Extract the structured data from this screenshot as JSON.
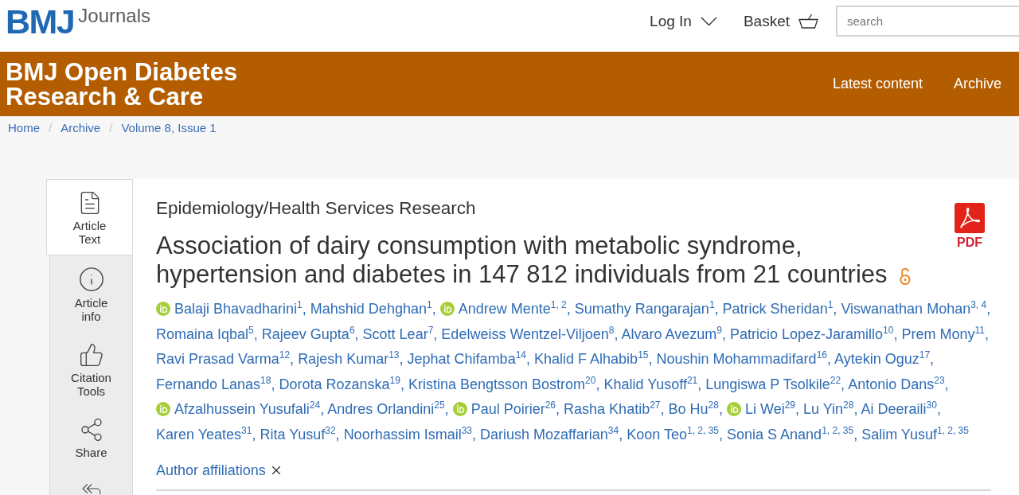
{
  "header": {
    "logo": {
      "mark": "BMJ",
      "wordmark": "Journals"
    },
    "login": {
      "label": "Log In"
    },
    "basket": {
      "label": "Basket"
    },
    "search": {
      "placeholder": "search"
    }
  },
  "journal_bar": {
    "title": "BMJ Open Diabetes Research & Care",
    "nav": [
      {
        "label": "Latest content"
      },
      {
        "label": "Archive"
      }
    ]
  },
  "breadcrumb": {
    "items": [
      "Home",
      "Archive",
      "Volume 8, Issue 1"
    ],
    "separator": "/"
  },
  "article_tabs": [
    {
      "label": "Article Text",
      "selected": true
    },
    {
      "label": "Article info",
      "selected": false
    },
    {
      "label": "Citation Tools",
      "selected": false
    },
    {
      "label": "Share",
      "selected": false
    },
    {
      "selected": false
    }
  ],
  "article": {
    "section": "Epidemiology/Health Services Research",
    "title": "Association of dairy consumption with metabolic syndrome, hypertension and diabetes in 147 812 individuals from 21 countries",
    "open_access": true,
    "pdf": {
      "label": "PDF"
    },
    "author_separator": ",",
    "authors": [
      {
        "name": "Balaji Bhavadharini",
        "affiliations": "1",
        "orcid": true
      },
      {
        "name": "Mahshid Dehghan",
        "affiliations": "1",
        "orcid": false
      },
      {
        "name": "Andrew Mente",
        "affiliations": "1, 2",
        "orcid": true
      },
      {
        "name": "Sumathy Rangarajan",
        "affiliations": "1",
        "orcid": false
      },
      {
        "name": "Patrick Sheridan",
        "affiliations": "1",
        "orcid": false
      },
      {
        "name": "Viswanathan Mohan",
        "affiliations": "3, 4",
        "orcid": false
      },
      {
        "name": "Romaina Iqbal",
        "affiliations": "5",
        "orcid": false
      },
      {
        "name": "Rajeev Gupta",
        "affiliations": "6",
        "orcid": false
      },
      {
        "name": "Scott Lear",
        "affiliations": "7",
        "orcid": false
      },
      {
        "name": "Edelweiss Wentzel-Viljoen",
        "affiliations": "8",
        "orcid": false
      },
      {
        "name": "Alvaro Avezum",
        "affiliations": "9",
        "orcid": false
      },
      {
        "name": "Patricio Lopez-Jaramillo",
        "affiliations": "10",
        "orcid": false
      },
      {
        "name": "Prem Mony",
        "affiliations": "11",
        "orcid": false
      },
      {
        "name": "Ravi Prasad Varma",
        "affiliations": "12",
        "orcid": false
      },
      {
        "name": "Rajesh Kumar",
        "affiliations": "13",
        "orcid": false
      },
      {
        "name": "Jephat Chifamba",
        "affiliations": "14",
        "orcid": false
      },
      {
        "name": "Khalid F Alhabib",
        "affiliations": "15",
        "orcid": false
      },
      {
        "name": "Noushin Mohammadifard",
        "affiliations": "16",
        "orcid": false
      },
      {
        "name": "Aytekin Oguz",
        "affiliations": "17",
        "orcid": false
      },
      {
        "name": "Fernando Lanas",
        "affiliations": "18",
        "orcid": false
      },
      {
        "name": "Dorota Rozanska",
        "affiliations": "19",
        "orcid": false
      },
      {
        "name": "Kristina Bengtsson Bostrom",
        "affiliations": "20",
        "orcid": false
      },
      {
        "name": "Khalid Yusoff",
        "affiliations": "21",
        "orcid": false
      },
      {
        "name": "Lungiswa P Tsolkile",
        "affiliations": "22",
        "orcid": false
      },
      {
        "name": "Antonio Dans",
        "affiliations": "23",
        "orcid": false
      },
      {
        "name": "Afzalhussein Yusufali",
        "affiliations": "24",
        "orcid": true
      },
      {
        "name": "Andres Orlandini",
        "affiliations": "25",
        "orcid": false
      },
      {
        "name": "Paul Poirier",
        "affiliations": "26",
        "orcid": true
      },
      {
        "name": "Rasha Khatib",
        "affiliations": "27",
        "orcid": false
      },
      {
        "name": "Bo Hu",
        "affiliations": "28",
        "orcid": false
      },
      {
        "name": "Li Wei",
        "affiliations": "29",
        "orcid": true
      },
      {
        "name": "Lu Yin",
        "affiliations": "28",
        "orcid": false
      },
      {
        "name": "Ai Deeraili",
        "affiliations": "30",
        "orcid": false
      },
      {
        "name": "Karen Yeates",
        "affiliations": "31",
        "orcid": false
      },
      {
        "name": "Rita Yusuf",
        "affiliations": "32",
        "orcid": false
      },
      {
        "name": "Noorhassim Ismail",
        "affiliations": "33",
        "orcid": false
      },
      {
        "name": "Dariush Mozaffarian",
        "affiliations": "34",
        "orcid": false
      },
      {
        "name": "Koon Teo",
        "affiliations": "1, 2, 35",
        "orcid": false
      },
      {
        "name": "Sonia S Anand",
        "affiliations": "1, 2, 35",
        "orcid": false
      },
      {
        "name": "Salim Yusuf",
        "affiliations": "1, 2, 35",
        "orcid": false
      }
    ],
    "affiliations_toggle": {
      "label": "Author affiliations"
    }
  }
}
